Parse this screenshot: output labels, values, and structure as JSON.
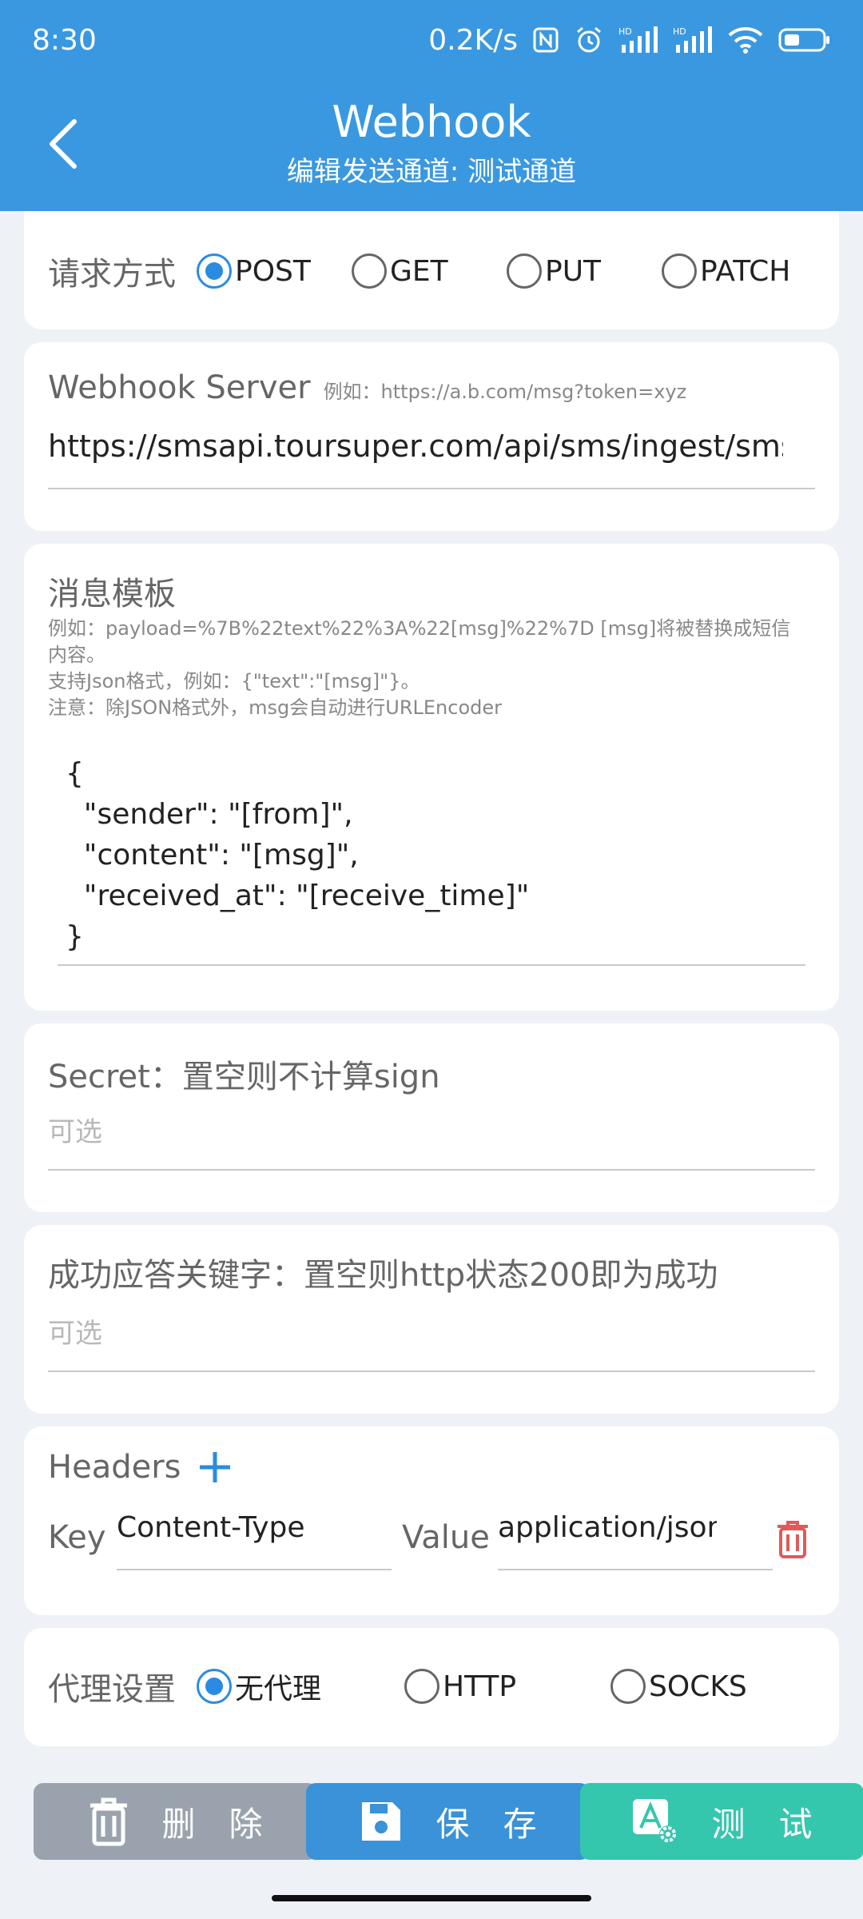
{
  "status": {
    "time": "8:30",
    "speed": "0.2K/s"
  },
  "header": {
    "title": "Webhook",
    "subtitle": "编辑发送通道: 测试通道"
  },
  "method": {
    "label": "请求方式",
    "options": [
      {
        "label": "POST",
        "checked": true
      },
      {
        "label": "GET",
        "checked": false
      },
      {
        "label": "PUT",
        "checked": false
      },
      {
        "label": "PATCH",
        "checked": false
      }
    ]
  },
  "server": {
    "label": "Webhook Server",
    "hint": "例如：https://a.b.com/msg?token=xyz",
    "value": "https://smsapi.toursuper.com/api/sms/ingest/sms"
  },
  "template": {
    "label": "消息模板",
    "hint_lines": [
      "例如：payload=%7B%22text%22%3A%22[msg]%22%7D [msg]将被替换成短信",
      "内容。",
      "支持Json格式，例如：{\"text\":\"[msg]\"}。",
      "注意：除JSON格式外，msg会自动进行URLEncoder"
    ],
    "value": "{\n  \"sender\": \"[from]\",\n  \"content\": \"[msg]\",\n  \"received_at\": \"[receive_time]\"\n}"
  },
  "secret": {
    "label": "Secret：置空则不计算sign",
    "placeholder": "可选"
  },
  "keyword": {
    "label": "成功应答关键字：置空则http状态200即为成功",
    "placeholder": "可选"
  },
  "headers": {
    "label": "Headers",
    "key_label": "Key",
    "value_label": "Value",
    "key": "Content-Type",
    "value": "application/json"
  },
  "proxy": {
    "label": "代理设置",
    "options": [
      {
        "label": "无代理",
        "checked": true
      },
      {
        "label": "HTTP",
        "checked": false
      },
      {
        "label": "SOCKS",
        "checked": false
      }
    ]
  },
  "buttons": {
    "delete": "删　除",
    "save": "保　存",
    "test": "测　试"
  },
  "colors": {
    "primary": "#3a98e0",
    "accent": "#2b8be0",
    "delete": "#9aa3ad",
    "save": "#3a92d8",
    "test": "#35c6ae",
    "danger": "#e05a5a"
  }
}
